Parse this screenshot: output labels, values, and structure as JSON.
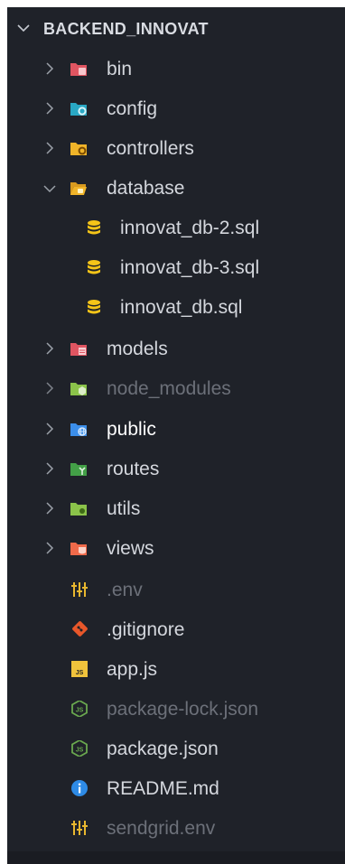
{
  "explorer": {
    "root_label": "BACKEND_INNOVAT",
    "items": [
      {
        "label": "bin",
        "kind": "folder",
        "icon": "folder-bin-icon",
        "color": "#e05561",
        "state": "collapsed"
      },
      {
        "label": "config",
        "kind": "folder",
        "icon": "folder-config-icon",
        "color": "#29a8c4",
        "state": "collapsed"
      },
      {
        "label": "controllers",
        "kind": "folder",
        "icon": "folder-controllers-icon",
        "color": "#f0b429",
        "state": "collapsed"
      },
      {
        "label": "database",
        "kind": "folder",
        "icon": "folder-database-icon",
        "color": "#f0b429",
        "state": "expanded"
      },
      {
        "label": "innovat_db-2.sql",
        "kind": "file",
        "icon": "database-file-icon",
        "color": "#f5c518"
      },
      {
        "label": "innovat_db-3.sql",
        "kind": "file",
        "icon": "database-file-icon",
        "color": "#f5c518"
      },
      {
        "label": "innovat_db.sql",
        "kind": "file",
        "icon": "database-file-icon",
        "color": "#f5c518"
      },
      {
        "label": "models",
        "kind": "folder",
        "icon": "folder-models-icon",
        "color": "#e05561",
        "state": "collapsed"
      },
      {
        "label": "node_modules",
        "kind": "folder",
        "icon": "folder-node-icon",
        "color": "#8bc34a",
        "state": "collapsed",
        "dim": true
      },
      {
        "label": "public",
        "kind": "folder",
        "icon": "folder-public-icon",
        "color": "#3b8eea",
        "state": "collapsed",
        "bright": true
      },
      {
        "label": "routes",
        "kind": "folder",
        "icon": "folder-routes-icon",
        "color": "#43a047",
        "state": "collapsed"
      },
      {
        "label": "utils",
        "kind": "folder",
        "icon": "folder-utils-icon",
        "color": "#8bc34a",
        "state": "collapsed"
      },
      {
        "label": "views",
        "kind": "folder",
        "icon": "folder-views-icon",
        "color": "#f06a4a",
        "state": "collapsed"
      },
      {
        "label": ".env",
        "kind": "file",
        "icon": "settings-sliders-icon",
        "color": "#e8b72f",
        "dim": true
      },
      {
        "label": ".gitignore",
        "kind": "file",
        "icon": "git-icon",
        "color": "#e8572a"
      },
      {
        "label": "app.js",
        "kind": "file",
        "icon": "javascript-icon",
        "color": "#f0c33c"
      },
      {
        "label": "package-lock.json",
        "kind": "file",
        "icon": "nodejs-icon",
        "color": "#6aa84f",
        "dim": true
      },
      {
        "label": "package.json",
        "kind": "file",
        "icon": "nodejs-icon",
        "color": "#6aa84f"
      },
      {
        "label": "README.md",
        "kind": "file",
        "icon": "info-icon",
        "color": "#2e8be6"
      },
      {
        "label": "sendgrid.env",
        "kind": "file",
        "icon": "settings-sliders-icon",
        "color": "#e8b72f",
        "dim": true
      }
    ]
  }
}
